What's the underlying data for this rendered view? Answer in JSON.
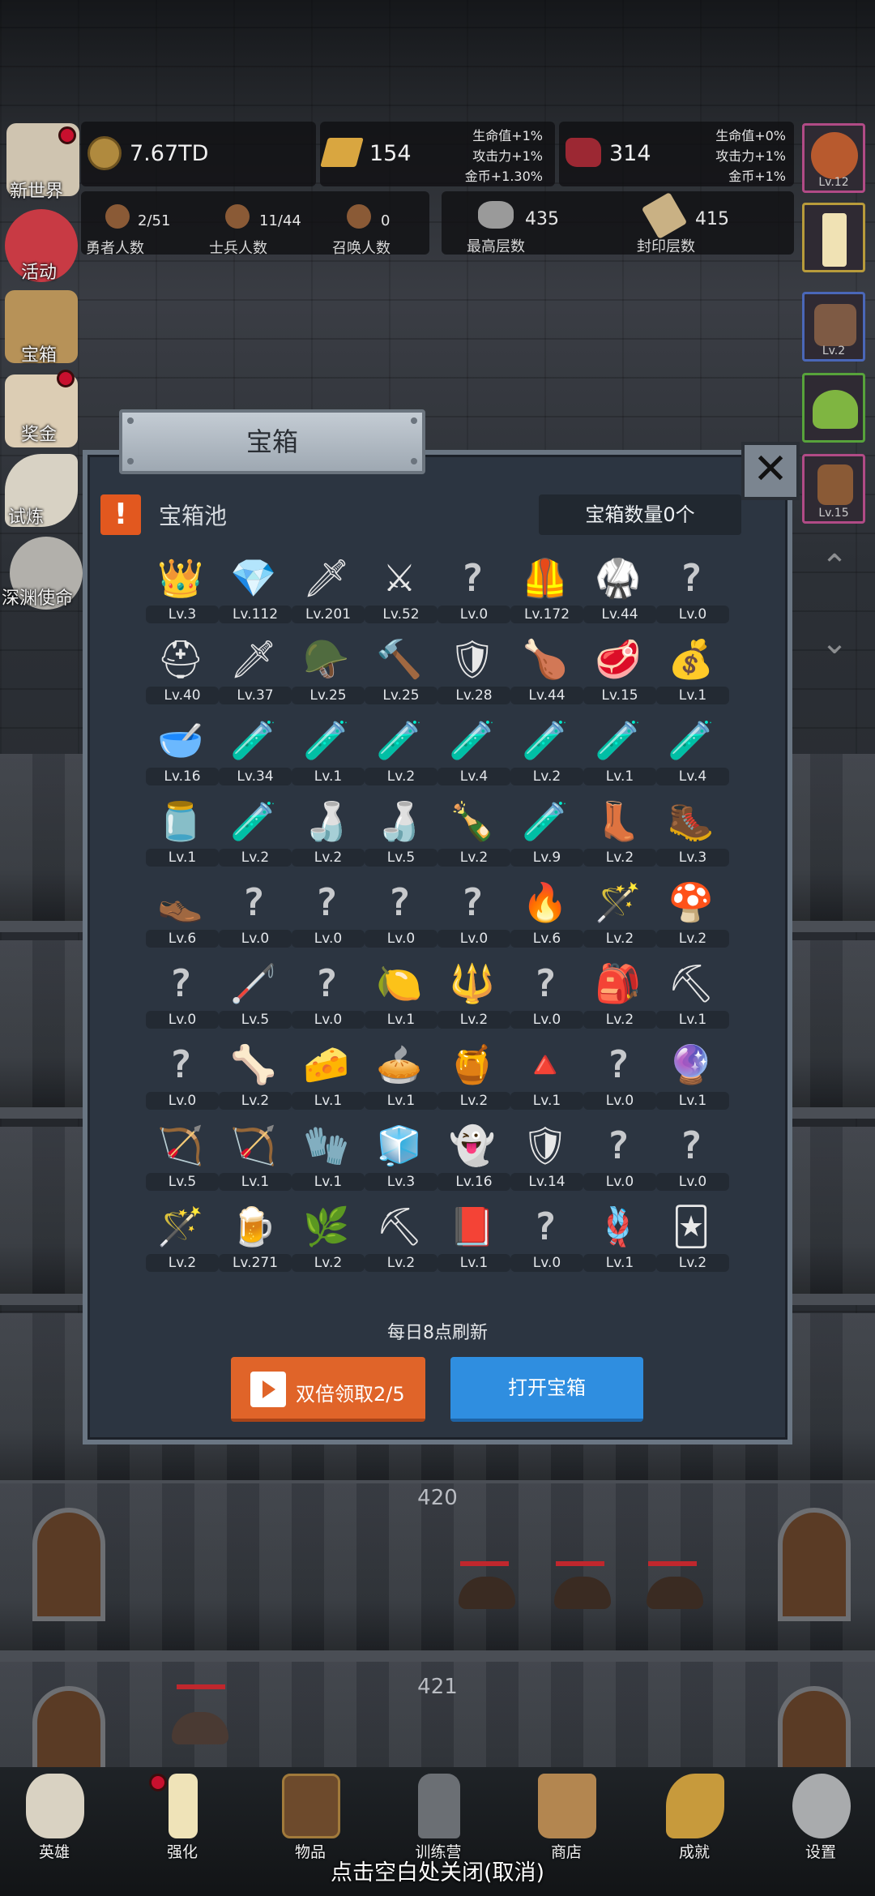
{
  "resources": {
    "gold": "7.67TD",
    "gold_bar": "154",
    "gold_bar_bonus": [
      "生命值+1%",
      "攻击力+1%",
      "金币+1.30%"
    ],
    "meat": "314",
    "meat_bonus": [
      "生命值+0%",
      "攻击力+1%",
      "金币+1%"
    ]
  },
  "counters": {
    "heroes": {
      "value": "2/51",
      "label": "勇者人数"
    },
    "soldiers": {
      "value": "11/44",
      "label": "士兵人数"
    },
    "summons": {
      "value": "0",
      "label": "召唤人数"
    },
    "max_floor": {
      "value": "435",
      "label": "最高层数"
    },
    "sealed_floor": {
      "value": "415",
      "label": "封印层数"
    }
  },
  "left_menu": [
    {
      "label": "新世界",
      "icon": "new-world-icon"
    },
    {
      "label": "活动",
      "icon": "heart-icon"
    },
    {
      "label": "宝箱",
      "icon": "chest-icon"
    },
    {
      "label": "奖金",
      "icon": "envelope-icon"
    },
    {
      "label": "试炼",
      "icon": "feather-icon"
    },
    {
      "label": "深渊使命",
      "icon": "abyss-icon"
    }
  ],
  "right_menu": {
    "labels": [
      "Lv.12",
      "",
      "Lv.2",
      "",
      "Lv.15"
    ]
  },
  "dialog": {
    "title": "宝箱",
    "close": "✕",
    "pool_label": "宝箱池",
    "chest_count": "宝箱数量0个",
    "refresh_note": "每日8点刷新",
    "double_button": "双倍领取2/5",
    "open_button": "打开宝箱"
  },
  "items": [
    {
      "icon": "crown-icon",
      "glyph": "👑",
      "lv": "Lv.3"
    },
    {
      "icon": "diamond-icon",
      "glyph": "💎",
      "lv": "Lv.112"
    },
    {
      "icon": "wooden-sword-icon",
      "glyph": "🗡",
      "lv": "Lv.201"
    },
    {
      "icon": "iron-sword-icon",
      "glyph": "⚔",
      "lv": "Lv.52"
    },
    {
      "icon": "unknown-icon",
      "glyph": "?",
      "lv": "Lv.0"
    },
    {
      "icon": "leather-armor-icon",
      "glyph": "🦺",
      "lv": "Lv.172"
    },
    {
      "icon": "chain-armor-icon",
      "glyph": "🥋",
      "lv": "Lv.44"
    },
    {
      "icon": "unknown-icon",
      "glyph": "?",
      "lv": "Lv.0"
    },
    {
      "icon": "leather-helmet-icon",
      "glyph": "⛑",
      "lv": "Lv.40"
    },
    {
      "icon": "dagger-icon",
      "glyph": "🗡",
      "lv": "Lv.37"
    },
    {
      "icon": "knight-helmet-icon",
      "glyph": "🪖",
      "lv": "Lv.25"
    },
    {
      "icon": "hammer-icon",
      "glyph": "🔨",
      "lv": "Lv.25"
    },
    {
      "icon": "great-helm-icon",
      "glyph": "🛡",
      "lv": "Lv.28"
    },
    {
      "icon": "ham-icon",
      "glyph": "🍗",
      "lv": "Lv.44"
    },
    {
      "icon": "steak-icon",
      "glyph": "🥩",
      "lv": "Lv.15"
    },
    {
      "icon": "blue-pouch-icon",
      "glyph": "💰",
      "lv": "Lv.1"
    },
    {
      "icon": "flour-bowl-icon",
      "glyph": "🥣",
      "lv": "Lv.16"
    },
    {
      "icon": "yellow-potion-icon",
      "glyph": "🧪",
      "lv": "Lv.34"
    },
    {
      "icon": "yellow-flask-icon",
      "glyph": "🧪",
      "lv": "Lv.1"
    },
    {
      "icon": "green-flask-icon",
      "glyph": "🧪",
      "lv": "Lv.2"
    },
    {
      "icon": "red-potion-icon",
      "glyph": "🧪",
      "lv": "Lv.4"
    },
    {
      "icon": "red-flask-icon",
      "glyph": "🧪",
      "lv": "Lv.2"
    },
    {
      "icon": "red-round-flask-icon",
      "glyph": "🧪",
      "lv": "Lv.1"
    },
    {
      "icon": "blue-potion-icon",
      "glyph": "🧪",
      "lv": "Lv.4"
    },
    {
      "icon": "blue-jar-icon",
      "glyph": "🫙",
      "lv": "Lv.1"
    },
    {
      "icon": "blue-round-flask-icon",
      "glyph": "🧪",
      "lv": "Lv.2"
    },
    {
      "icon": "empty-bottle-icon",
      "glyph": "🍶",
      "lv": "Lv.2"
    },
    {
      "icon": "teal-bottle-icon",
      "glyph": "🍶",
      "lv": "Lv.5"
    },
    {
      "icon": "green-bottle-icon",
      "glyph": "🍾",
      "lv": "Lv.2"
    },
    {
      "icon": "red-vial-icon",
      "glyph": "🧪",
      "lv": "Lv.9"
    },
    {
      "icon": "winged-boot-icon",
      "glyph": "👢",
      "lv": "Lv.2"
    },
    {
      "icon": "leather-boot-icon",
      "glyph": "🥾",
      "lv": "Lv.3"
    },
    {
      "icon": "shoe-icon",
      "glyph": "👞",
      "lv": "Lv.6"
    },
    {
      "icon": "unknown-icon",
      "glyph": "?",
      "lv": "Lv.0"
    },
    {
      "icon": "unknown-icon",
      "glyph": "?",
      "lv": "Lv.0"
    },
    {
      "icon": "unknown-icon",
      "glyph": "?",
      "lv": "Lv.0"
    },
    {
      "icon": "unknown-icon",
      "glyph": "?",
      "lv": "Lv.0"
    },
    {
      "icon": "torch-icon",
      "glyph": "🔥",
      "lv": "Lv.6"
    },
    {
      "icon": "fire-wand-icon",
      "glyph": "🪄",
      "lv": "Lv.2"
    },
    {
      "icon": "mushroom-icon",
      "glyph": "🍄",
      "lv": "Lv.2"
    },
    {
      "icon": "unknown-icon",
      "glyph": "?",
      "lv": "Lv.0"
    },
    {
      "icon": "wooden-staff-icon",
      "glyph": "🦯",
      "lv": "Lv.5"
    },
    {
      "icon": "unknown-icon",
      "glyph": "?",
      "lv": "Lv.0"
    },
    {
      "icon": "lime-icon",
      "glyph": "🍋",
      "lv": "Lv.1"
    },
    {
      "icon": "blue-scepter-icon",
      "glyph": "🔱",
      "lv": "Lv.2"
    },
    {
      "icon": "unknown-icon",
      "glyph": "?",
      "lv": "Lv.0"
    },
    {
      "icon": "backpack-icon",
      "glyph": "🎒",
      "lv": "Lv.2"
    },
    {
      "icon": "shovel-icon",
      "glyph": "⛏",
      "lv": "Lv.1"
    },
    {
      "icon": "unknown-icon",
      "glyph": "?",
      "lv": "Lv.0"
    },
    {
      "icon": "bone-club-icon",
      "glyph": "🦴",
      "lv": "Lv.2"
    },
    {
      "icon": "cheese-icon",
      "glyph": "🧀",
      "lv": "Lv.1"
    },
    {
      "icon": "pie-icon",
      "glyph": "🥧",
      "lv": "Lv.1"
    },
    {
      "icon": "honey-jar-icon",
      "glyph": "🍯",
      "lv": "Lv.2"
    },
    {
      "icon": "red-crystal-icon",
      "glyph": "🔺",
      "lv": "Lv.1"
    },
    {
      "icon": "unknown-icon",
      "glyph": "?",
      "lv": "Lv.0"
    },
    {
      "icon": "rainbow-orb-icon",
      "glyph": "🔮",
      "lv": "Lv.1"
    },
    {
      "icon": "bow-icon",
      "glyph": "🏹",
      "lv": "Lv.5"
    },
    {
      "icon": "crossbow-icon",
      "glyph": "🏹",
      "lv": "Lv.1"
    },
    {
      "icon": "flame-gauntlet-icon",
      "glyph": "🧤",
      "lv": "Lv.1"
    },
    {
      "icon": "frost-gauntlet-icon",
      "glyph": "🧊",
      "lv": "Lv.3"
    },
    {
      "icon": "spirit-gauntlet-icon",
      "glyph": "👻",
      "lv": "Lv.16"
    },
    {
      "icon": "emerald-shield-icon",
      "glyph": "🛡",
      "lv": "Lv.14"
    },
    {
      "icon": "unknown-icon",
      "glyph": "?",
      "lv": "Lv.0"
    },
    {
      "icon": "unknown-icon",
      "glyph": "?",
      "lv": "Lv.0"
    },
    {
      "icon": "green-wand-icon",
      "glyph": "🪄",
      "lv": "Lv.2"
    },
    {
      "icon": "beer-mug-icon",
      "glyph": "🍺",
      "lv": "Lv.271"
    },
    {
      "icon": "vine-icon",
      "glyph": "🌿",
      "lv": "Lv.2"
    },
    {
      "icon": "golden-pickaxe-icon",
      "glyph": "⛏",
      "lv": "Lv.2"
    },
    {
      "icon": "red-book-icon",
      "glyph": "📕",
      "lv": "Lv.1"
    },
    {
      "icon": "unknown-icon",
      "glyph": "?",
      "lv": "Lv.0"
    },
    {
      "icon": "rope-icon",
      "glyph": "🪢",
      "lv": "Lv.1"
    },
    {
      "icon": "monster-card-icon",
      "glyph": "🃏",
      "lv": "Lv.2"
    }
  ],
  "floors": [
    "420",
    "421"
  ],
  "bottom_nav": [
    {
      "label": "英雄",
      "icon": "skull-icon"
    },
    {
      "label": "强化",
      "icon": "candle-icon"
    },
    {
      "label": "物品",
      "icon": "book-icon"
    },
    {
      "label": "训练营",
      "icon": "lantern-icon"
    },
    {
      "label": "商店",
      "icon": "beer-icon"
    },
    {
      "label": "成就",
      "icon": "key-icon"
    },
    {
      "label": "设置",
      "icon": "gear-icon"
    }
  ],
  "close_hint": "点击空白处关闭(取消)",
  "colors": {
    "dialog_bg": "#2c3541",
    "accent_orange": "#e06429",
    "accent_blue": "#2f8ee0",
    "notification_red": "#c8102e"
  }
}
